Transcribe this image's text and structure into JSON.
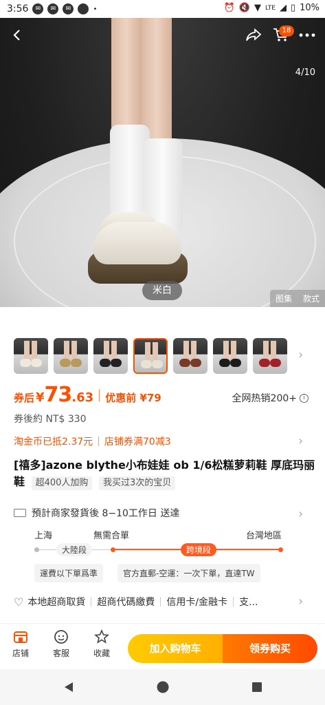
{
  "status_bar": {
    "time": "3:56",
    "battery": "10%",
    "network": "LTE"
  },
  "header": {
    "cart_count": "18",
    "page_counter": "4/10"
  },
  "hero": {
    "color_label": "米白",
    "view_tabs": [
      "图集",
      "款式"
    ]
  },
  "thumbnails": [
    {
      "shoe": "#efe9dc"
    },
    {
      "shoe": "#b89a5a"
    },
    {
      "shoe": "#222222"
    },
    {
      "shoe": "#e8e2d4",
      "selected": true
    },
    {
      "shoe": "#7a3a2a"
    },
    {
      "shoe": "#1c1c1c"
    },
    {
      "shoe": "#a3222a"
    }
  ],
  "price": {
    "coupon_label": "券后",
    "currency": "¥",
    "amount_int": "73",
    "amount_dec": ".63",
    "pre_discount": "优惠前 ¥79",
    "hot_sales": "全网热销200+",
    "twd": "券後約 NT$ 330"
  },
  "promo": {
    "coin": "淘金币已抵2.37元",
    "shop_coupon": "店铺券满70减3"
  },
  "product": {
    "title": "[禧多]azone blythe小布娃娃 ob 1/6松糕萝莉鞋 厚底玛丽鞋",
    "tags": [
      "超400人加购",
      "我买过3次的宝贝"
    ]
  },
  "shipping": {
    "estimate": "預計商家發貨後 8−10工作日 送達",
    "origin": "上海",
    "middle": "無需合單",
    "destination": "台灣地區",
    "seg1": "大陸段",
    "seg2": "跨境段",
    "box1": "運費以下單爲準",
    "box2": "官方直郵-空運：一次下單，直達TW"
  },
  "services": [
    "本地超商取貨",
    "超商代碼繳費",
    "信用卡/金融卡",
    "支..."
  ],
  "action_bar": {
    "shop": "店铺",
    "service": "客服",
    "favorite": "收藏",
    "add_to_cart": "加入购物车",
    "buy_with_coupon": "领券购买"
  },
  "colors": {
    "accent": "#ff5000",
    "cart_yellow": "#ffbd00",
    "buy_orange": "#ff5a00"
  }
}
